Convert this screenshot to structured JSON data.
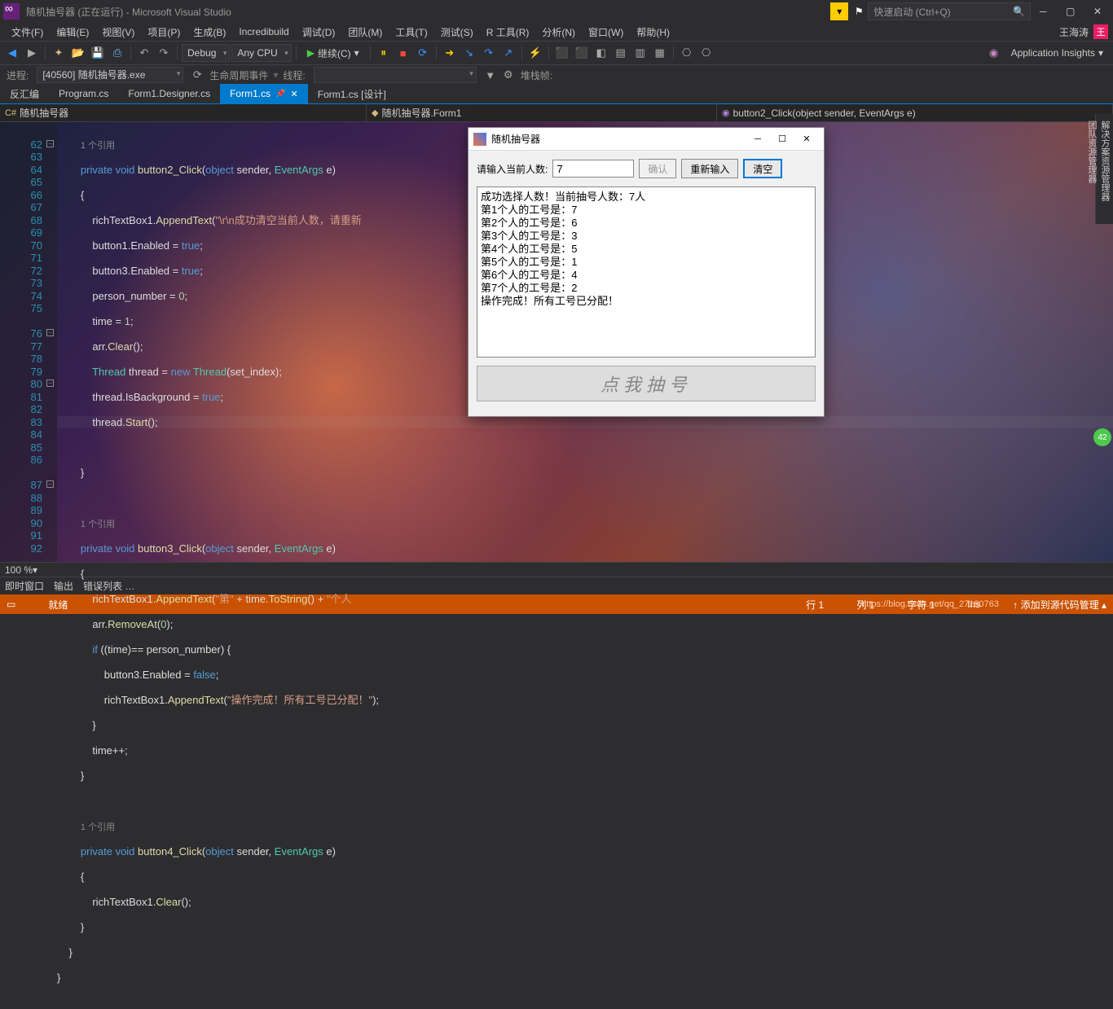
{
  "title": "随机抽号器 (正在运行) - Microsoft Visual Studio",
  "quicklaunch_ph": "快速启动 (Ctrl+Q)",
  "user": "王海涛",
  "user_initial": "王",
  "menu": [
    "文件(F)",
    "编辑(E)",
    "视图(V)",
    "项目(P)",
    "生成(B)",
    "Incredibuild",
    "调试(D)",
    "团队(M)",
    "工具(T)",
    "测试(S)",
    "R 工具(R)",
    "分析(N)",
    "窗口(W)",
    "帮助(H)"
  ],
  "config": "Debug",
  "platform": "Any CPU",
  "continue": "继续(C)",
  "insights": "Application Insights",
  "process_label": "进程:",
  "process": "[40560] 随机抽号器.exe",
  "lifecycle": "生命周期事件",
  "thread_label": "线程:",
  "stackframe": "堆栈帧:",
  "tabs": {
    "disasm": "反汇编",
    "program": "Program.cs",
    "designer": "Form1.Designer.cs",
    "form1": "Form1.cs",
    "form1design": "Form1.cs [设计]"
  },
  "bread1": "随机抽号器",
  "bread2": "随机抽号器.Form1",
  "bread3": "button2_Click(object sender, EventArgs e)",
  "code": {
    "ref": "1 个引用",
    "lines_start": 62,
    "str1": "\"\\r\\n成功清空当前人数，请重新",
    "str2": "\"第\"",
    "str3": "\"个人",
    "str4": "\"操作完成！所有工号已分配！\""
  },
  "zoom": "100 %",
  "bottom_tabs": [
    "即时窗口",
    "输出",
    "错误列表 …"
  ],
  "status": {
    "ready": "就绪",
    "line": "行 1",
    "col": "列 1",
    "char": "字符 1",
    "ins": "Ins",
    "add_source": "添加到源代码管理",
    "wm": "https://blog.csdn.net/qq_27180763"
  },
  "app": {
    "title": "随机抽号器",
    "prompt": "请输入当前人数:",
    "value": "7",
    "btn_ok": "确认",
    "btn_re": "重新输入",
    "btn_clear": "清空",
    "output": "成功选择人数！当前抽号人数：7人\n第1个人的工号是：7\n第2个人的工号是：6\n第3个人的工号是：3\n第4个人的工号是：5\n第5个人的工号是：1\n第6个人的工号是：4\n第7个人的工号是：2\n操作完成！所有工号已分配！",
    "bigbtn": "点我抽号"
  }
}
